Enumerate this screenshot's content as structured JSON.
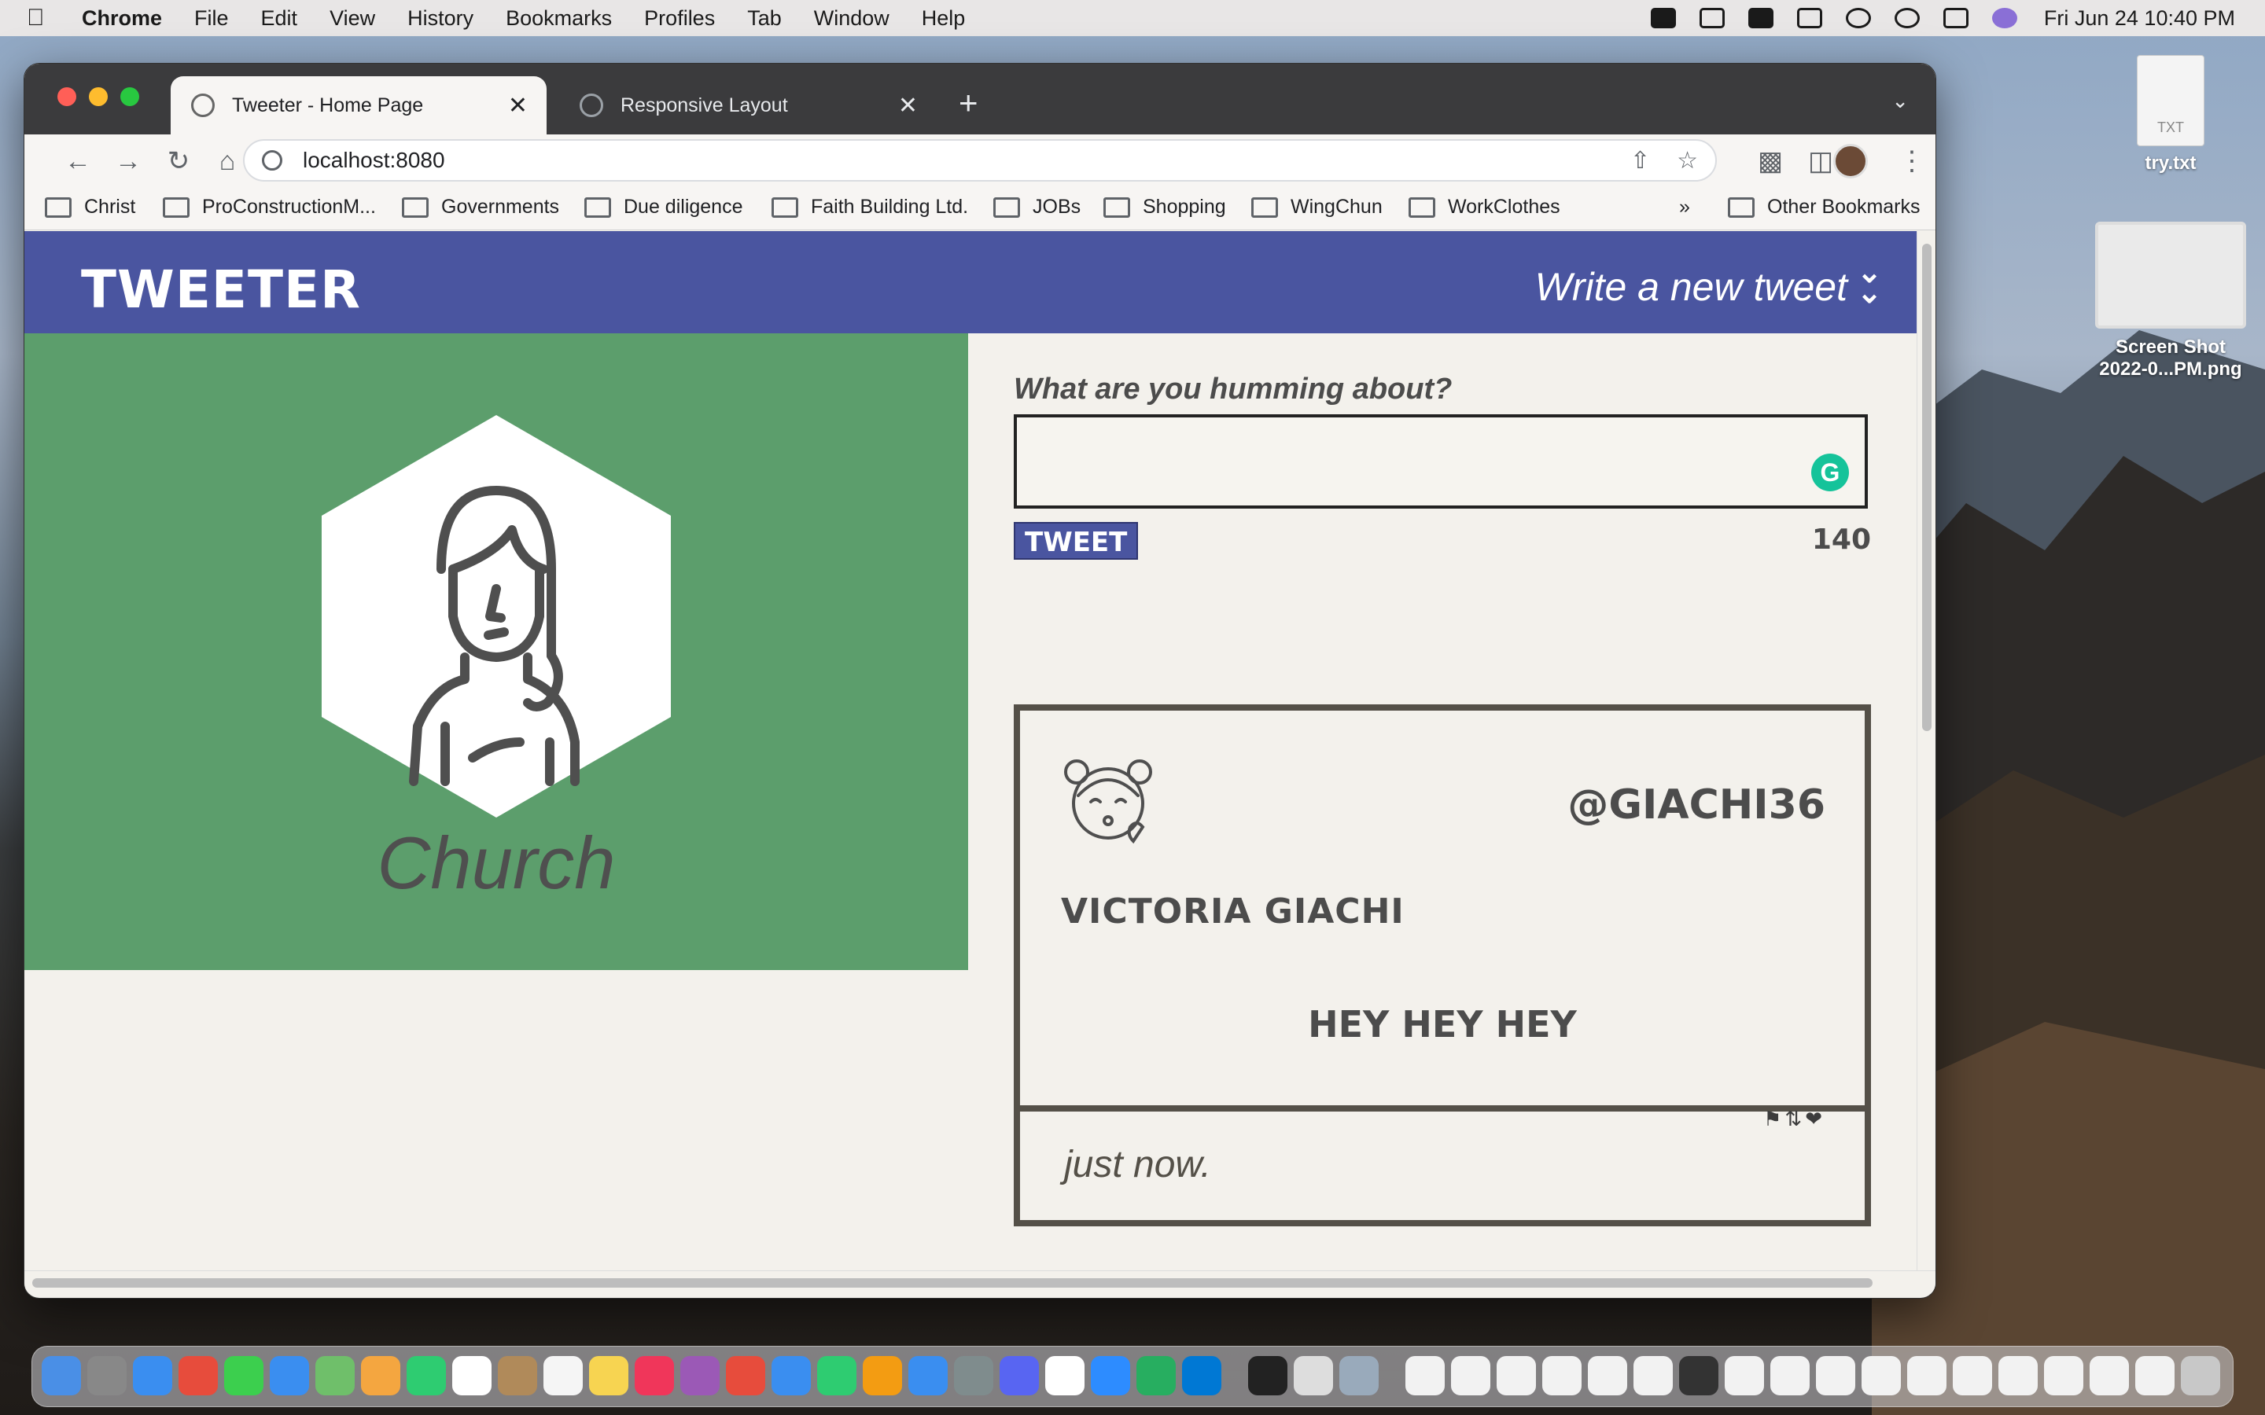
{
  "menubar": {
    "app": "Chrome",
    "items": [
      "File",
      "Edit",
      "View",
      "History",
      "Bookmarks",
      "Profiles",
      "Tab",
      "Window",
      "Help"
    ],
    "clock": "Fri Jun 24  10:40 PM"
  },
  "desktop": {
    "file_label": "try.txt",
    "file_type": "TXT",
    "screenshot_label_1": "Screen Shot",
    "screenshot_label_2": "2022-0...PM.png"
  },
  "browser": {
    "tabs": [
      {
        "title": "Tweeter - Home Page",
        "active": true
      },
      {
        "title": "Responsive Layout",
        "active": false
      }
    ],
    "url": "localhost:8080",
    "bookmarks": [
      "Christ",
      "ProConstructionM...",
      "Governments",
      "Due diligence",
      "Faith Building Ltd.",
      "JOBs",
      "Shopping",
      "WingChun",
      "WorkClothes"
    ],
    "bookmarks_overflow": "»",
    "other_bookmarks": "Other Bookmarks"
  },
  "page": {
    "nav": {
      "logo": "TWEETER",
      "compose_link": "Write a new tweet",
      "compose_icon": "double-chevron-down-icon"
    },
    "profile": {
      "name": "Church",
      "background_color": "#5c9e6c"
    },
    "compose": {
      "label": "What are you humming about?",
      "input_value": "",
      "button": "TWEET",
      "counter": "140"
    },
    "tweets": [
      {
        "handle": "@GIACHI36",
        "name": "VICTORIA GIACHI",
        "content": "HEY HEY HEY",
        "timestamp": "just now.",
        "actions": [
          "flag-icon",
          "retweet-icon",
          "heart-icon"
        ]
      }
    ],
    "accent_color": "#4a55a0"
  }
}
